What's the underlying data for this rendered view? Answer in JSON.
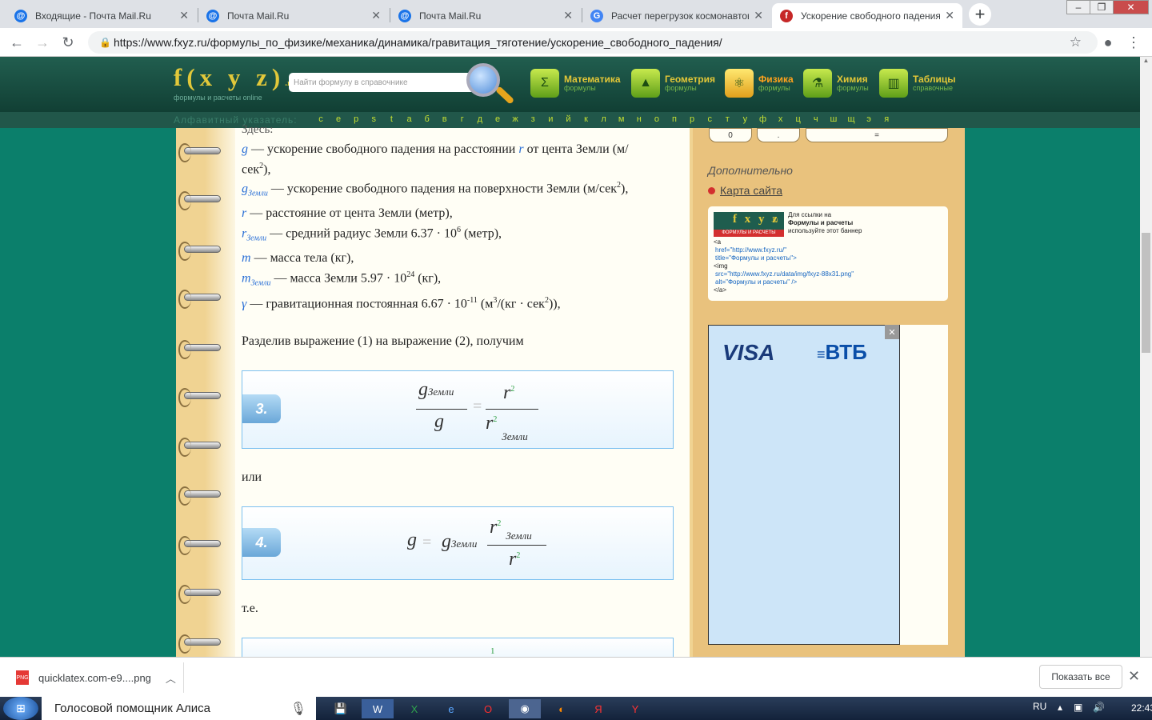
{
  "browser": {
    "tabs": [
      {
        "title": "Входящие - Почта Mail.Ru",
        "favicon": "@",
        "color": "#1a73e8"
      },
      {
        "title": "Почта Mail.Ru",
        "favicon": "@",
        "color": "#1a73e8"
      },
      {
        "title": "Почта Mail.Ru",
        "favicon": "@",
        "color": "#1a73e8"
      },
      {
        "title": "Расчет перегрузок космонавтов",
        "favicon": "G",
        "color": "#4285f4"
      },
      {
        "title": "Ускорение свободного падения",
        "favicon": "f",
        "color": "#c62828"
      }
    ],
    "url": "https://www.fxyz.ru/формулы_по_физике/механика/динамика/гравитация_тяготение/ускорение_свободного_падения/"
  },
  "site": {
    "logo": "f(x y z)",
    "logo_domain": ".ru",
    "logo_sub": "формулы и расчеты online",
    "search_placeholder": "Найти формулу в справочнике",
    "categories": [
      {
        "name": "Математика",
        "sub": "формулы",
        "icon": "Σ"
      },
      {
        "name": "Геометрия",
        "sub": "формулы",
        "icon": "▲"
      },
      {
        "name": "Физика",
        "sub": "формулы",
        "icon": "⚛"
      },
      {
        "name": "Химия",
        "sub": "формулы",
        "icon": "⚗"
      },
      {
        "name": "Таблицы",
        "sub": "справочные",
        "icon": "▥"
      }
    ],
    "alpha_label": "Алфавитный указатель:",
    "alpha": [
      "c",
      "e",
      "p",
      "s",
      "t",
      "а",
      "б",
      "в",
      "г",
      "д",
      "е",
      "ж",
      "з",
      "и",
      "й",
      "к",
      "л",
      "м",
      "н",
      "о",
      "п",
      "р",
      "с",
      "т",
      "у",
      "ф",
      "х",
      "ц",
      "ч",
      "ш",
      "щ",
      "э",
      "я"
    ]
  },
  "content": {
    "here": "Здесь:",
    "defs": [
      "— ускорение свободного падения на расстоянии",
      "от цента Земли (м/",
      "сек",
      ",",
      "— ускорение свободного падения на поверхности Земли (м/сек",
      ")",
      "— расстояние от цента Земли (метр),",
      "— средний радиус Земли 6.37 · 10",
      "(метр),",
      "— масса тела (кг),",
      "— масса Земли 5.97 · 10",
      "(кг),",
      "— гравитационная постоянная 6.67 · 10",
      "(м",
      "/(кг · сек",
      "))"
    ],
    "sym_g": "g",
    "sym_r": "r",
    "sym_m": "m",
    "sym_gamma": "γ",
    "sub_earth": "Земли",
    "sup2": "2",
    "sup3": "3",
    "sup6": "6",
    "sup24": "24",
    "supm11": "-11",
    "divide_text": "Разделив выражение (1) на выражение (2), получим",
    "formula3_num": "3.",
    "or_text": "или",
    "formula4_num": "4.",
    "ie_text": "т.е.",
    "eq": "=",
    "partial_1": "1"
  },
  "sidebar": {
    "calc_btns": [
      "0",
      ".",
      "="
    ],
    "extra_title": "Дополнительно",
    "sitemap": "Карта сайта",
    "banner_logo": "f x y z",
    "banner_logo_dom": ".ru",
    "banner_strip": "ФОРМУЛЫ И РАСЧЕТЫ",
    "banner_text1": "Для ссылки на",
    "banner_text2": "Формулы и расчеты",
    "banner_text3": "используйте этот баннер",
    "code": [
      "<a",
      "href=\"http://www.fxyz.ru/\"",
      "title=\"Формулы и расчеты\">",
      "<img",
      "src=\"http://www.fxyz.ru/data/img/fxyz-88x31.png\"",
      "alt=\"Формулы и расчеты\" />",
      "</a>"
    ],
    "ad_visa": "VISA",
    "ad_vtb": "ВТБ",
    "ad_close": "✕"
  },
  "downloads": {
    "file": "quicklatex.com-e9....png",
    "show_all": "Показать все",
    "icon": "PNG"
  },
  "taskbar": {
    "alice": "Голосовой помощник Алиса",
    "lang": "RU",
    "time": "22:43"
  }
}
